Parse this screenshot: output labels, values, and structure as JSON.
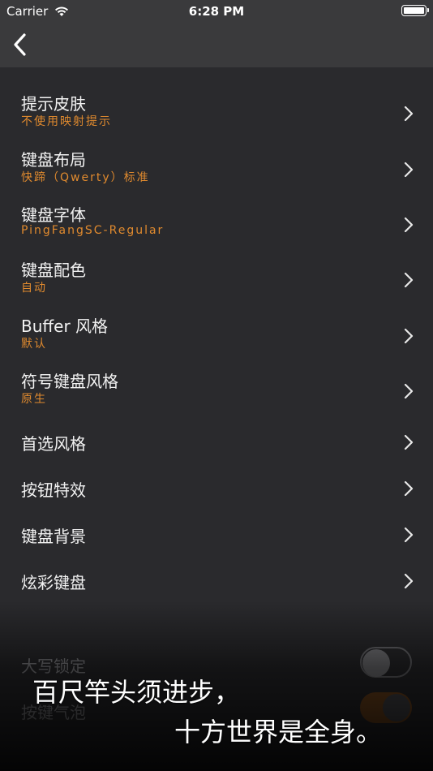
{
  "status_bar": {
    "carrier": "Carrier",
    "time": "6:28 PM",
    "wifi_icon": "wifi-icon",
    "battery_icon": "battery-icon"
  },
  "nav": {
    "back_icon": "chevron-left-icon"
  },
  "settings": [
    {
      "title": "提示皮肤",
      "subtitle": "不使用映射提示"
    },
    {
      "title": "键盘布局",
      "subtitle": "快蹄（Qwerty）标准"
    },
    {
      "title": "键盘字体",
      "subtitle": "PingFangSC-Regular"
    },
    {
      "title": "键盘配色",
      "subtitle": "自动"
    },
    {
      "title": "Buffer 风格",
      "subtitle": "默认"
    },
    {
      "title": "符号键盘风格",
      "subtitle": "原生"
    },
    {
      "title": "首选风格"
    },
    {
      "title": "按钮特效"
    },
    {
      "title": "键盘背景"
    },
    {
      "title": "炫彩键盘"
    }
  ],
  "toggles": [
    {
      "title": "大写锁定",
      "state": "off"
    },
    {
      "title": "按键气泡",
      "state": "on"
    }
  ],
  "overlay": {
    "line1": "百尺竿头须进步，",
    "line2": "十方世界是全身。"
  },
  "colors": {
    "background": "#2a2a2d",
    "bar": "#3a3a3c",
    "accent": "#e08a2e"
  }
}
